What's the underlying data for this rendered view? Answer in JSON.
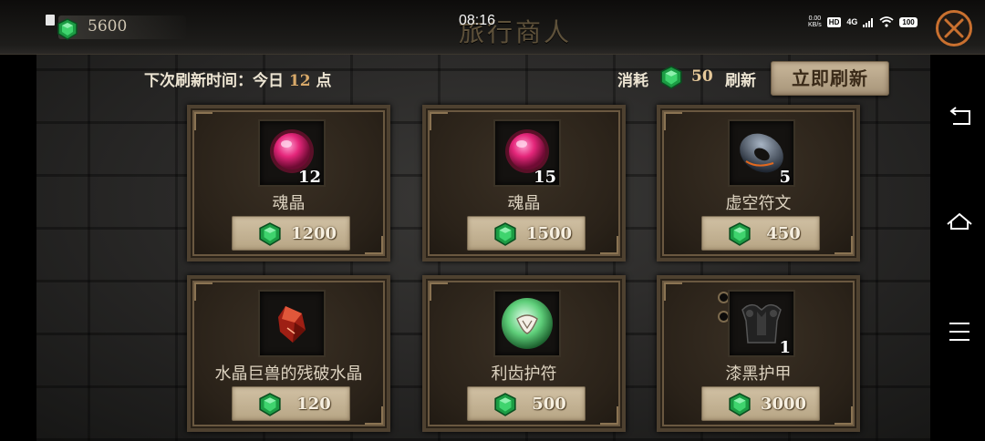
{
  "status_bar": {
    "time": "08:16",
    "network_speed_value": "0.00",
    "network_speed_unit": "KB/s",
    "hd_badge": "HD",
    "network_type": "4G",
    "battery": "100"
  },
  "header": {
    "title": "旅行商人",
    "currency_amount": "5600"
  },
  "refresh": {
    "label_prefix": "下次刷新时间：",
    "label_day": "今日",
    "label_hour": "12",
    "label_suffix": "点",
    "cost_label": "消耗",
    "cost_value": "50",
    "refresh_word": "刷新",
    "button_label": "立即刷新"
  },
  "items": [
    {
      "name": "魂晶",
      "quantity": "12",
      "price": "1200",
      "icon": "pink-soul-crystal-icon"
    },
    {
      "name": "魂晶",
      "quantity": "15",
      "price": "1500",
      "icon": "pink-soul-crystal-icon"
    },
    {
      "name": "虚空符文",
      "quantity": "5",
      "price": "450",
      "icon": "void-rune-icon"
    },
    {
      "name": "水晶巨兽的残破水晶",
      "quantity": "",
      "price": "120",
      "icon": "red-crystal-shard-icon"
    },
    {
      "name": "利齿护符",
      "quantity": "",
      "price": "500",
      "icon": "tooth-amulet-icon"
    },
    {
      "name": "漆黑护甲",
      "quantity": "1",
      "price": "3000",
      "icon": "black-armor-icon"
    }
  ],
  "colors": {
    "gem_green": "#1fae4e",
    "accent_gold": "#d8a969",
    "close_ring": "#c9702f"
  }
}
